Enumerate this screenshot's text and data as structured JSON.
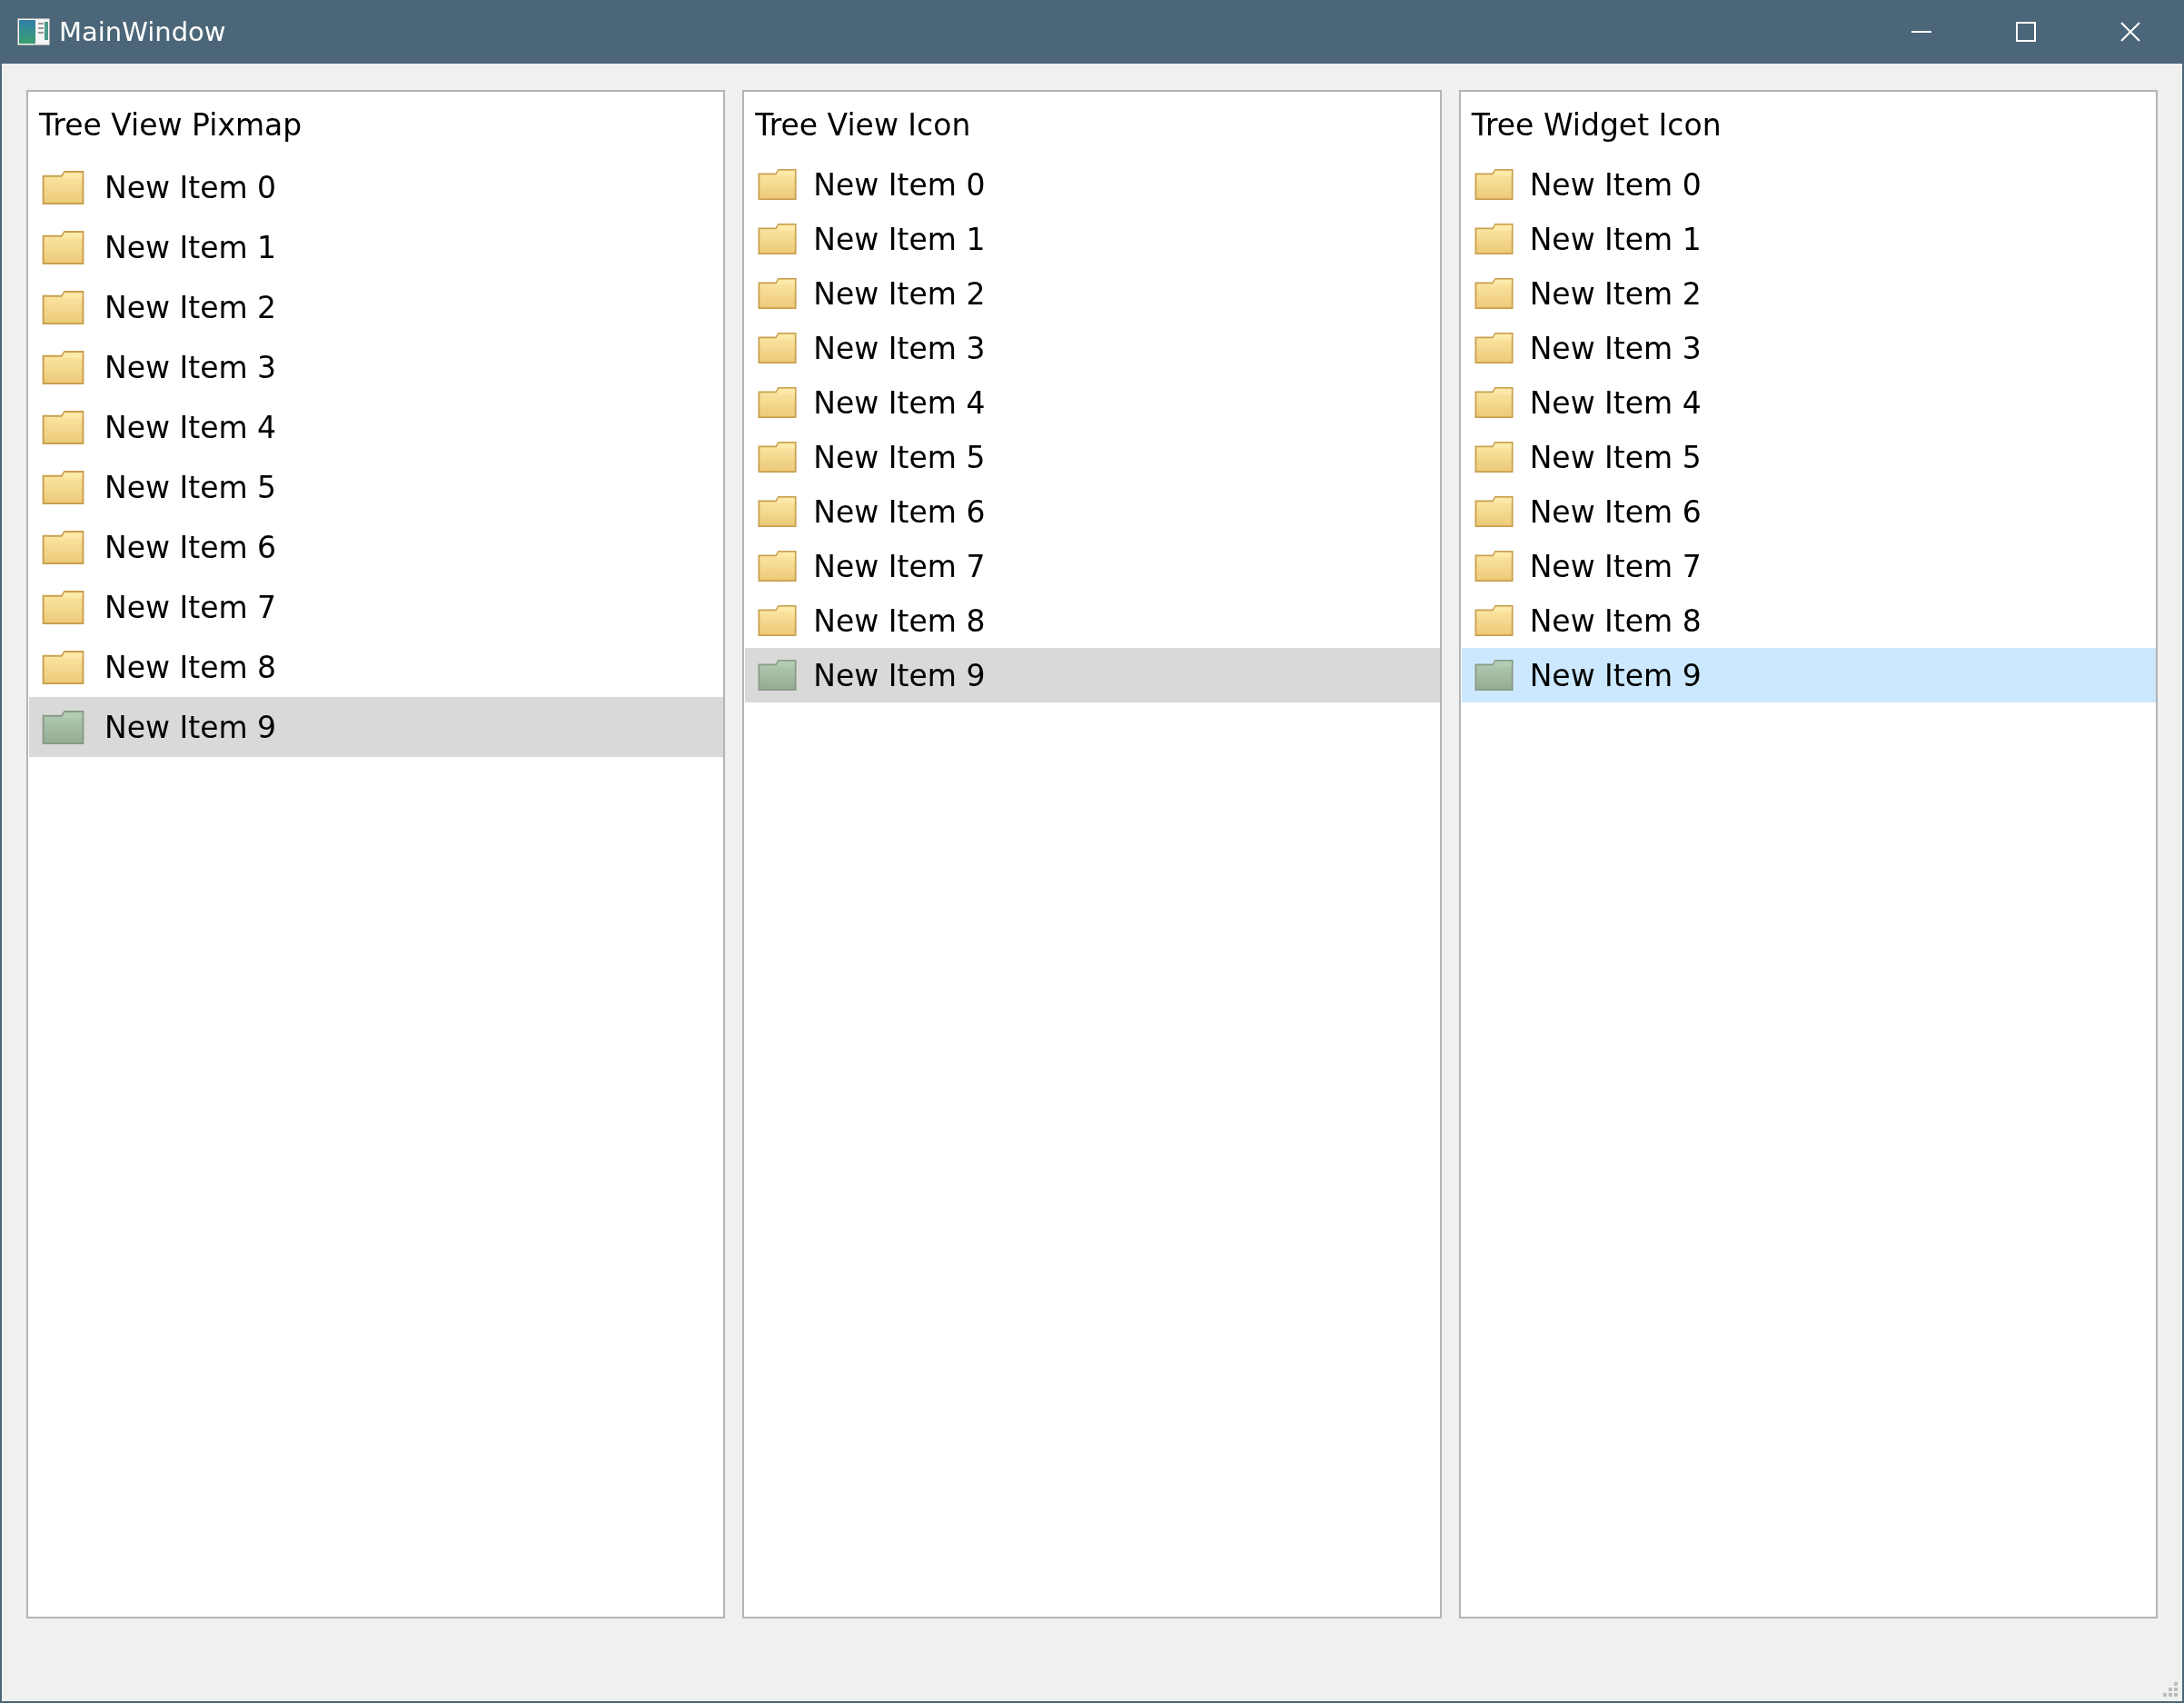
{
  "window": {
    "title": "MainWindow"
  },
  "panels": [
    {
      "kind": "pixmap",
      "header": "Tree View Pixmap",
      "focused": false,
      "items": [
        {
          "label": "New Item 0",
          "selected": false
        },
        {
          "label": "New Item 1",
          "selected": false
        },
        {
          "label": "New Item 2",
          "selected": false
        },
        {
          "label": "New Item 3",
          "selected": false
        },
        {
          "label": "New Item 4",
          "selected": false
        },
        {
          "label": "New Item 5",
          "selected": false
        },
        {
          "label": "New Item 6",
          "selected": false
        },
        {
          "label": "New Item 7",
          "selected": false
        },
        {
          "label": "New Item 8",
          "selected": false
        },
        {
          "label": "New Item 9",
          "selected": true
        }
      ]
    },
    {
      "kind": "icon",
      "header": "Tree View Icon",
      "focused": false,
      "items": [
        {
          "label": "New Item 0",
          "selected": false
        },
        {
          "label": "New Item 1",
          "selected": false
        },
        {
          "label": "New Item 2",
          "selected": false
        },
        {
          "label": "New Item 3",
          "selected": false
        },
        {
          "label": "New Item 4",
          "selected": false
        },
        {
          "label": "New Item 5",
          "selected": false
        },
        {
          "label": "New Item 6",
          "selected": false
        },
        {
          "label": "New Item 7",
          "selected": false
        },
        {
          "label": "New Item 8",
          "selected": false
        },
        {
          "label": "New Item 9",
          "selected": true
        }
      ]
    },
    {
      "kind": "icon",
      "header": "Tree Widget Icon",
      "focused": true,
      "items": [
        {
          "label": "New Item 0",
          "selected": false
        },
        {
          "label": "New Item 1",
          "selected": false
        },
        {
          "label": "New Item 2",
          "selected": false
        },
        {
          "label": "New Item 3",
          "selected": false
        },
        {
          "label": "New Item 4",
          "selected": false
        },
        {
          "label": "New Item 5",
          "selected": false
        },
        {
          "label": "New Item 6",
          "selected": false
        },
        {
          "label": "New Item 7",
          "selected": false
        },
        {
          "label": "New Item 8",
          "selected": false
        },
        {
          "label": "New Item 9",
          "selected": true
        }
      ]
    }
  ]
}
